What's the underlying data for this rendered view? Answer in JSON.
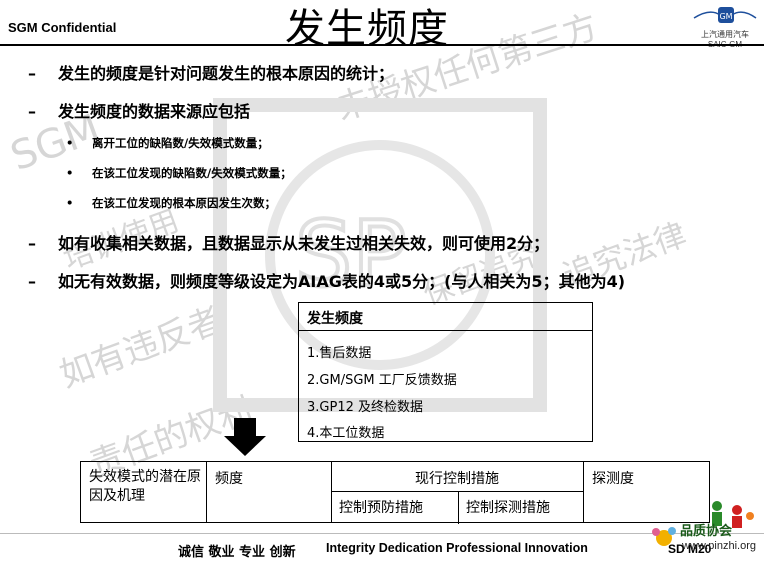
{
  "header": {
    "confidential": "SGM Confidential",
    "title": "发生频度",
    "logo_cn": "上汽通用汽车",
    "logo_en": "SAIC-GM"
  },
  "bullets": [
    "发生的频度是针对问题发生的根本原因的统计；",
    "发生频度的数据来源应包括"
  ],
  "sub_bullets": [
    "离开工位的缺陷数/失效模式数量；",
    "在该工位发现的缺陷数/失效模式数量；",
    "在该工位发现的根本原因发生次数；"
  ],
  "bullets2": [
    "如有收集相关数据，且数据显示从未发生过相关失效，则可使用2分；",
    "如无有效数据，则频度等级设定为AIAG表的4或5分；(与人相关为5；其他为4)"
  ],
  "source_box": {
    "header": "发生频度",
    "items": [
      "1.售后数据",
      "2.GM/SGM 工厂反馈数据",
      "3.GP12 及终检数据",
      "4.本工位数据"
    ]
  },
  "fmea_table": {
    "col1": "失效模式的潜在原因及机理",
    "col2": "频度",
    "col3": "现行控制措施",
    "col3a": "控制预防措施",
    "col3b": "控制探测措施",
    "col4": "探测度"
  },
  "footer": {
    "cn": "诚信 敬业 专业 创新",
    "en": "Integrity  Dedication  Professional  Innovation",
    "page_prefix": "SD M",
    "page_no": "20",
    "site": "www.pinzhi.org",
    "site_brand": "品质协会"
  },
  "watermarks": [
    "SGM",
    "未授权任何第三方",
    "培训使用",
    "如有违反者",
    "追究法律",
    "责任的权利",
    "保留追究"
  ],
  "colors": {
    "accent_arrow": "#000000",
    "watermark": "#d6d6d6",
    "logo_blue": "#1e4f9c"
  }
}
